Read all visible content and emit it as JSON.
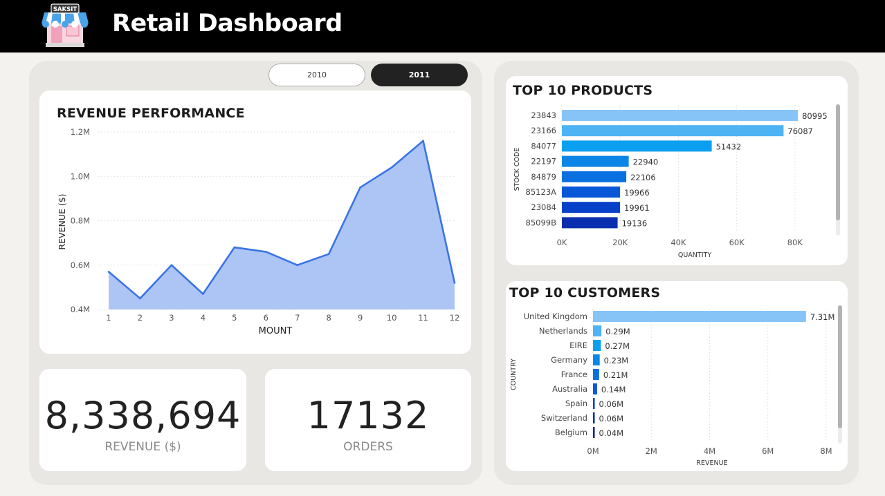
{
  "header": {
    "title": "Retail Dashboard",
    "logo_text": "SAKSIT"
  },
  "filters": {
    "years": [
      {
        "label": "2010",
        "selected": false
      },
      {
        "label": "2011",
        "selected": true
      }
    ]
  },
  "colors": {
    "area_fill": "#adc5f5",
    "area_line": "#3a73e6",
    "bar_palette": [
      "#86c4f7",
      "#4db3f3",
      "#0aa0ef",
      "#0b86e6",
      "#0a70e0",
      "#0857d6",
      "#0740c9",
      "#0a2fae",
      "#0b2496",
      "#5e8bb5"
    ]
  },
  "revenue_card": {
    "title": "REVENUE PERFORMANCE"
  },
  "products_card": {
    "title": "TOP 10 PRODUCTS"
  },
  "customers_card": {
    "title": "TOP 10 CUSTOMERS"
  },
  "kpis": {
    "revenue": {
      "value": "8,338,694",
      "label": "REVENUE ($)"
    },
    "orders": {
      "value": "17132",
      "label": "ORDERS"
    }
  },
  "chart_data": [
    {
      "type": "area",
      "title": "REVENUE PERFORMANCE",
      "xlabel": "MOUNT",
      "ylabel": "REVENUE ($)",
      "x": [
        1,
        2,
        3,
        4,
        5,
        6,
        7,
        8,
        9,
        10,
        11,
        12
      ],
      "values": [
        0.57,
        0.45,
        0.6,
        0.47,
        0.68,
        0.66,
        0.6,
        0.65,
        0.95,
        1.04,
        1.16,
        0.52
      ],
      "y_unit": "M",
      "ylim": [
        0.4,
        1.2
      ],
      "y_ticks": [
        "0.4M",
        "0.6M",
        "0.8M",
        "1.0M",
        "1.2M"
      ],
      "x_ticks": [
        "1",
        "2",
        "3",
        "4",
        "5",
        "6",
        "7",
        "8",
        "9",
        "10",
        "11",
        "12"
      ],
      "grid": true
    },
    {
      "type": "bar",
      "orientation": "horizontal",
      "title": "TOP 10 PRODUCTS",
      "xlabel": "QUANTITY",
      "ylabel": "STOCK CODE",
      "categories": [
        "23843",
        "23166",
        "84077",
        "22197",
        "84879",
        "85123A",
        "23084",
        "85099B"
      ],
      "values": [
        80995,
        76087,
        51432,
        22940,
        22106,
        19966,
        19961,
        19136
      ],
      "data_labels": [
        "80995",
        "76087",
        "51432",
        "22940",
        "22106",
        "19966",
        "19961",
        "19136"
      ],
      "xlim": [
        0,
        90000
      ],
      "x_ticks": [
        "0K",
        "20K",
        "40K",
        "60K",
        "80K"
      ],
      "grid": true
    },
    {
      "type": "bar",
      "orientation": "horizontal",
      "title": "TOP 10 CUSTOMERS",
      "xlabel": "REVENUE",
      "ylabel": "COUNTRY",
      "categories": [
        "United Kingdom",
        "Netherlands",
        "EIRE",
        "Germany",
        "France",
        "Australia",
        "Spain",
        "Switzerland",
        "Belgium"
      ],
      "values": [
        7.31,
        0.29,
        0.27,
        0.23,
        0.21,
        0.14,
        0.06,
        0.06,
        0.04
      ],
      "data_labels": [
        "7.31M",
        "0.29M",
        "0.27M",
        "0.23M",
        "0.21M",
        "0.14M",
        "0.06M",
        "0.06M",
        "0.04M"
      ],
      "x_unit": "M",
      "xlim": [
        0,
        8.5
      ],
      "x_ticks": [
        "0M",
        "2M",
        "4M",
        "6M",
        "8M"
      ],
      "grid": true
    }
  ]
}
